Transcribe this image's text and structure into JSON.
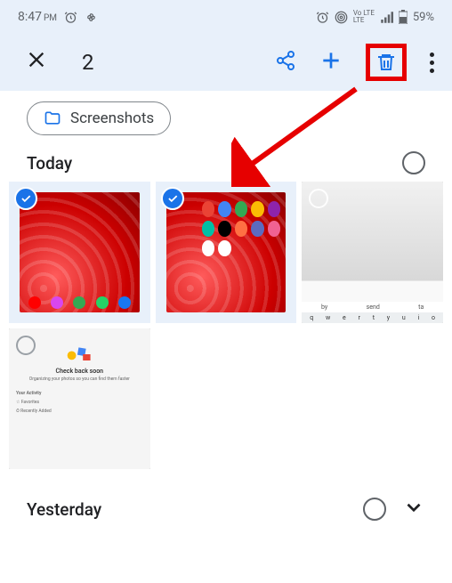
{
  "status": {
    "time": "8:47",
    "ampm": "PM",
    "battery": "59%"
  },
  "selection": {
    "count": "2"
  },
  "filters": {
    "chip1": "Screenshots"
  },
  "sections": {
    "today": "Today",
    "yesterday": "Yesterday"
  },
  "thumb3": {
    "suggest1": "by",
    "suggest2": "send",
    "suggest3": "ta"
  },
  "thumb4": {
    "heading": "Check back soon",
    "sub": "Organizing your photos so you can find them faster",
    "activity": "Your Activity",
    "fav": "Favorites",
    "recent": "Recently Added"
  }
}
